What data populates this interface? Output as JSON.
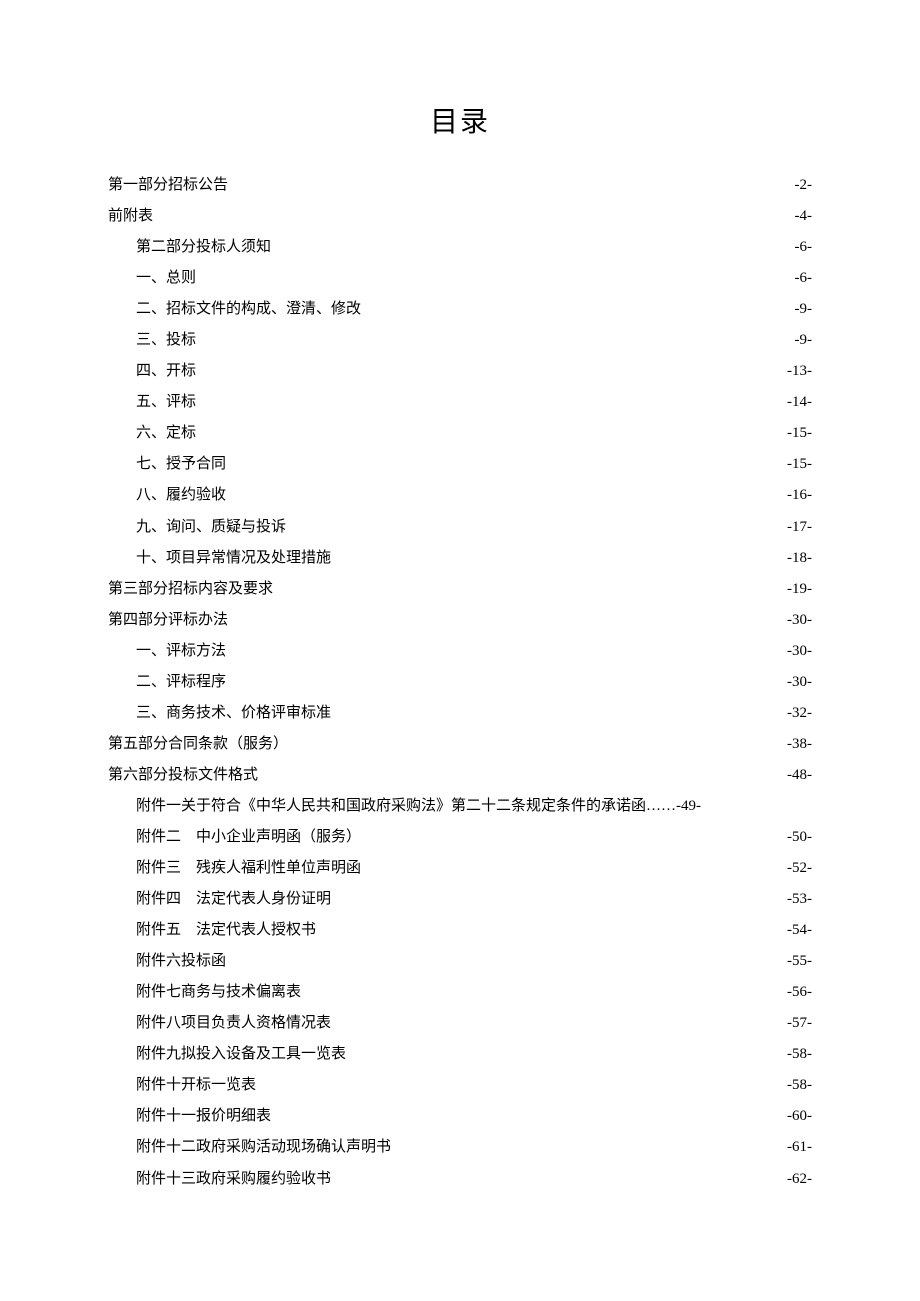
{
  "title": "目录",
  "entries": [
    {
      "label": "第一部分招标公告",
      "page": "-2-",
      "indent": false
    },
    {
      "label": "前附表",
      "page": "-4-",
      "indent": false
    },
    {
      "label": "第二部分投标人须知",
      "page": "-6-",
      "indent": true
    },
    {
      "label": "一、总则",
      "page": "-6-",
      "indent": true
    },
    {
      "label": "二、招标文件的构成、澄清、修改",
      "page": "-9-",
      "indent": true
    },
    {
      "label": "三、投标",
      "page": "-9-",
      "indent": true
    },
    {
      "label": "四、开标",
      "page": "-13-",
      "indent": true
    },
    {
      "label": "五、评标",
      "page": "-14-",
      "indent": true
    },
    {
      "label": "六、定标",
      "page": "-15-",
      "indent": true
    },
    {
      "label": "七、授予合同",
      "page": "-15-",
      "indent": true
    },
    {
      "label": "八、履约验收",
      "page": "-16-",
      "indent": true
    },
    {
      "label": "九、询问、质疑与投诉",
      "page": "-17-",
      "indent": true
    },
    {
      "label": "十、项目异常情况及处理措施",
      "page": "-18-",
      "indent": true
    },
    {
      "label": "第三部分招标内容及要求",
      "page": "-19-",
      "indent": false
    },
    {
      "label": "第四部分评标办法",
      "page": "-30-",
      "indent": false
    },
    {
      "label": "一、评标方法",
      "page": "-30-",
      "indent": true
    },
    {
      "label": "二、评标程序",
      "page": "-30-",
      "indent": true
    },
    {
      "label": "三、商务技术、价格评审标准",
      "page": "-32-",
      "indent": true
    },
    {
      "label": "第五部分合同条款（服务）",
      "page": "-38-",
      "indent": false
    },
    {
      "label": "第六部分投标文件格式",
      "page": "-48-",
      "indent": false
    },
    {
      "label": "附件一关于符合《中华人民共和国政府采购法》第二十二条规定条件的承诺函……-49-",
      "page": "",
      "indent": true,
      "nodots": true
    },
    {
      "label": "附件二　中小企业声明函（服务）",
      "page": "-50-",
      "indent": true
    },
    {
      "label": "附件三　残疾人福利性单位声明函",
      "page": "-52-",
      "indent": true
    },
    {
      "label": "附件四　法定代表人身份证明",
      "page": "-53-",
      "indent": true
    },
    {
      "label": "附件五　法定代表人授权书",
      "page": "-54-",
      "indent": true
    },
    {
      "label": "附件六投标函",
      "page": "-55-",
      "indent": true
    },
    {
      "label": "附件七商务与技术偏离表",
      "page": "-56-",
      "indent": true
    },
    {
      "label": "附件八项目负责人资格情况表",
      "page": "-57-",
      "indent": true
    },
    {
      "label": "附件九拟投入设备及工具一览表",
      "page": "-58-",
      "indent": true
    },
    {
      "label": "附件十开标一览表",
      "page": "-58-",
      "indent": true
    },
    {
      "label": "附件十一报价明细表",
      "page": "-60-",
      "indent": true
    },
    {
      "label": "附件十二政府采购活动现场确认声明书",
      "page": "-61-",
      "indent": true
    },
    {
      "label": "附件十三政府采购履约验收书",
      "page": "-62-",
      "indent": true
    }
  ]
}
